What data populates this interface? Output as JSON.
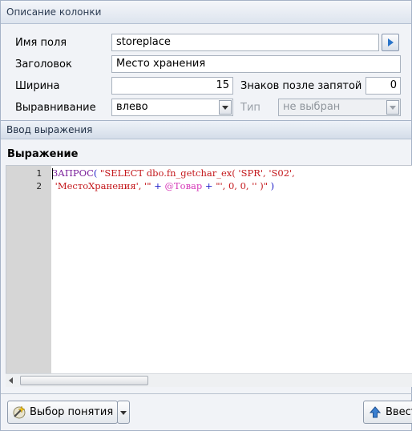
{
  "column_dialog": {
    "title": "Описание колонки",
    "field_name": {
      "label": "Имя поля",
      "value": "storeplace"
    },
    "caption": {
      "label": "Заголовок",
      "value": "Место хранения"
    },
    "width": {
      "label": "Ширина",
      "value": "15"
    },
    "decimals": {
      "label": "Знаков позле запятой",
      "value": "0"
    },
    "alignment": {
      "label": "Выравнивание",
      "value": "влево"
    },
    "type": {
      "label": "Тип",
      "value": "не выбран",
      "enabled": false
    }
  },
  "expression_dialog": {
    "title": "Ввод выражения",
    "heading": "Выражение",
    "editor": {
      "line_numbers": [
        "1",
        "2"
      ],
      "line1": {
        "fn": "ЗАПРОС",
        "paren": "( ",
        "str": "\"SELECT dbo.fn_getchar_ex( 'SPR', 'S02',"
      },
      "line2": {
        "str1": " 'МестоХранения', '\"",
        "plus1": " + ",
        "var": "@Товар",
        "plus2": " + ",
        "str2": "\"', 0, 0, '' )\"",
        "close": " )"
      }
    },
    "buttons": {
      "concept": "Выбор понятия",
      "enter": "Ввест"
    }
  },
  "colors": {
    "keyword": "#7a1f9a",
    "string": "#c4181c",
    "variable": "#d63ab8",
    "operator": "#1a1ac8"
  }
}
